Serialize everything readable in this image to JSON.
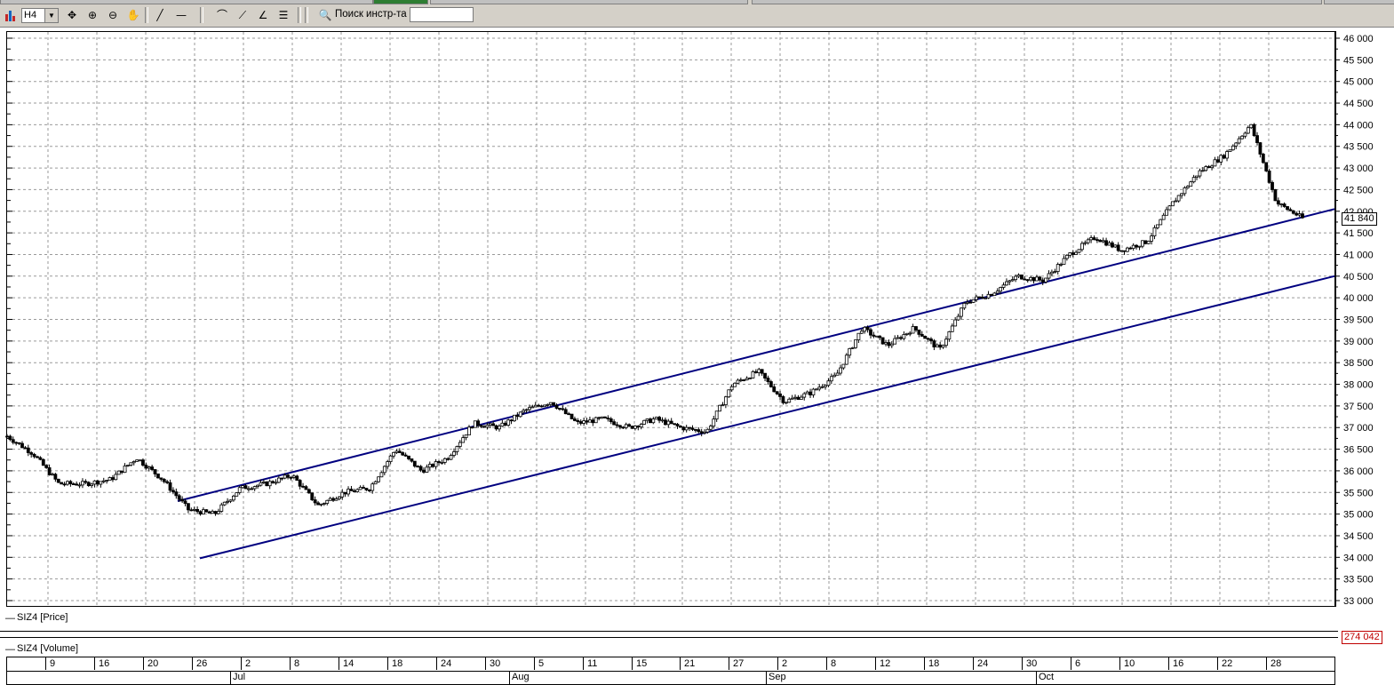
{
  "toolbar": {
    "timeframe": "H4",
    "search_label": "Поиск инстр-та",
    "search_value": "",
    "icons": [
      "bar-chart-icon",
      "move-icon",
      "zoom-in-icon",
      "zoom-out-icon",
      "hand-icon",
      "line-tool-icon",
      "horizontal-line-icon",
      "fibonacci-arc-icon",
      "fibonacci-fan-icon",
      "gann-fan-icon",
      "fibonacci-retracement-icon",
      "search-icon"
    ]
  },
  "price_panel": {
    "label": "SIZ4 [Price]",
    "current_price": "41 840",
    "current_price_value": 41840,
    "y_ticks": [
      "46 000",
      "45 500",
      "45 000",
      "44 500",
      "44 000",
      "43 500",
      "43 000",
      "42 500",
      "42 000",
      "41 500",
      "41 000",
      "40 500",
      "40 000",
      "39 500",
      "39 000",
      "38 500",
      "38 000",
      "37 500",
      "37 000",
      "36 500",
      "36 000",
      "35 500",
      "35 000",
      "34 500",
      "34 000",
      "33 500",
      "33 000"
    ]
  },
  "volume_panel": {
    "label": "SIZ4 [Volume]",
    "current_volume": "274 042",
    "current_volume_value": 274042
  },
  "time_axis": {
    "days": [
      "9",
      "16",
      "20",
      "26",
      "2",
      "8",
      "14",
      "18",
      "24",
      "30",
      "5",
      "11",
      "15",
      "21",
      "27",
      "2",
      "8",
      "12",
      "18",
      "24",
      "30",
      "6",
      "10",
      "16",
      "22",
      "28"
    ],
    "months": [
      "Jul",
      "Aug",
      "Sep",
      "Oct"
    ]
  },
  "chart_data": {
    "type": "candlestick",
    "instrument": "SIZ4",
    "timeframe": "H4",
    "ylim": [
      33000,
      46000
    ],
    "y_tick_step": 500,
    "grid": true,
    "trend_lines": [
      {
        "name": "upper",
        "points": [
          [
            0.0,
            35300
          ],
          [
            1.0,
            42050
          ]
        ]
      },
      {
        "name": "lower",
        "points": [
          [
            0.0,
            33850
          ],
          [
            1.0,
            40500
          ]
        ]
      }
    ],
    "close_path": [
      36800,
      36400,
      35700,
      35700,
      35800,
      36300,
      35800,
      35100,
      35000,
      35600,
      35700,
      35900,
      35200,
      35500,
      35600,
      36500,
      36000,
      36300,
      37100,
      37000,
      37400,
      37600,
      37100,
      37200,
      37000,
      37200,
      37000,
      36900,
      38000,
      38300,
      37600,
      37800,
      38200,
      39300,
      38900,
      39300,
      38800,
      39900,
      40100,
      40500,
      40400,
      41000,
      41400,
      41100,
      41300,
      42200,
      42900,
      43300,
      44000,
      42200,
      41840
    ]
  }
}
